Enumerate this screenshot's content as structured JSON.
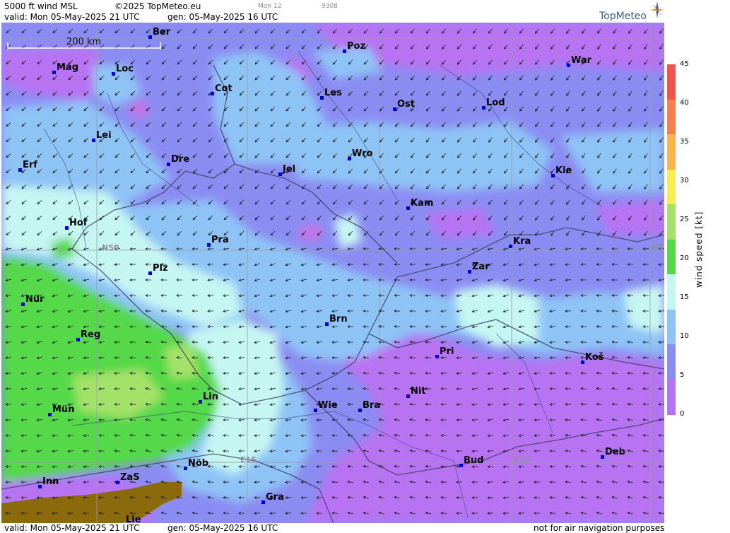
{
  "header": {
    "product": "5000 ft wind MSL",
    "copyright": "©2025 TopMeteo.eu",
    "valid": "valid:  Mon  05-May-2025  21 UTC",
    "gen": "gen: 05-May-2025 16 UTC",
    "small1": "Mon 12",
    "small2": "9308",
    "logo": "TopMeteo"
  },
  "footer": {
    "valid": "valid:  Mon  05-May-2025  21 UTC",
    "gen": "gen: 05-May-2025 16 UTC",
    "disclaimer": "not for air navigation purposes"
  },
  "scale_bar": "200 km",
  "grid_labels": {
    "lat": "N50",
    "lat_right": "N5",
    "lon15": "E15",
    "lon20": "E20"
  },
  "legend": {
    "title": "wind speed [kt]",
    "ticks": [
      "45",
      "40",
      "35",
      "30",
      "25",
      "20",
      "15",
      "10",
      "5",
      "0"
    ],
    "colors": [
      "#f2544a",
      "#f4804e",
      "#f7b54e",
      "#f9ec55",
      "#a4e16a",
      "#55d84a",
      "#c6f6f2",
      "#8ec3f6",
      "#8b8cf2",
      "#b773f2"
    ]
  },
  "cities": [
    {
      "name": "Ber"
    },
    {
      "name": "Poz"
    },
    {
      "name": "War"
    },
    {
      "name": "Mag"
    },
    {
      "name": "Loc"
    },
    {
      "name": "Cot"
    },
    {
      "name": "Les"
    },
    {
      "name": "Lod"
    },
    {
      "name": "Ost"
    },
    {
      "name": "Lei"
    },
    {
      "name": "Wro"
    },
    {
      "name": "Dre"
    },
    {
      "name": "Erf"
    },
    {
      "name": "Jel"
    },
    {
      "name": "Kie"
    },
    {
      "name": "Kam"
    },
    {
      "name": "Hof"
    },
    {
      "name": "Pra"
    },
    {
      "name": "Kra"
    },
    {
      "name": "Plz"
    },
    {
      "name": "Zar"
    },
    {
      "name": "Nür"
    },
    {
      "name": "Brn"
    },
    {
      "name": "Reg"
    },
    {
      "name": "Pri"
    },
    {
      "name": "Koš"
    },
    {
      "name": "Lin"
    },
    {
      "name": "Nit"
    },
    {
      "name": "Mün"
    },
    {
      "name": "Wie"
    },
    {
      "name": "Bra"
    },
    {
      "name": "Deb"
    },
    {
      "name": "Nöb"
    },
    {
      "name": "Bud"
    },
    {
      "name": "Inn"
    },
    {
      "name": "ZaS"
    },
    {
      "name": "Gra"
    },
    {
      "name": "Lie"
    }
  ]
}
